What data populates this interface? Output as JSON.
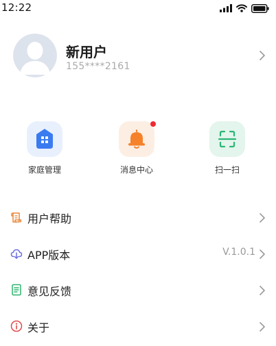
{
  "status_bar": {
    "time": "12:22",
    "icons": [
      "signal-icon",
      "wifi-icon",
      "battery-icon"
    ]
  },
  "profile": {
    "name": "新用户",
    "phone": "155****2161",
    "avatar_icon": "default-avatar-icon",
    "chevron_icon": "chevron-right-icon"
  },
  "shortcuts": [
    {
      "label": "家庭管理",
      "icon": "home-management-icon",
      "color": "#3a7bf0"
    },
    {
      "label": "消息中心",
      "icon": "bell-icon",
      "color": "#f5822a",
      "has_badge": true
    },
    {
      "label": "扫一扫",
      "icon": "scan-icon",
      "color": "#29b774"
    }
  ],
  "menu": [
    {
      "label": "用户帮助",
      "icon": "help-scroll-icon",
      "color": "#e8873a",
      "value": ""
    },
    {
      "label": "APP版本",
      "icon": "cloud-download-icon",
      "color": "#6d6fe0",
      "value": "V.1.0.1"
    },
    {
      "label": "意见反馈",
      "icon": "feedback-document-icon",
      "color": "#2cb56f",
      "value": ""
    },
    {
      "label": "关于",
      "icon": "info-icon",
      "color": "#e24a4a",
      "value": ""
    }
  ],
  "colors": {
    "badge": "#ee2a33",
    "chevron": "#999999",
    "secondary_text": "#aaaaaa"
  }
}
